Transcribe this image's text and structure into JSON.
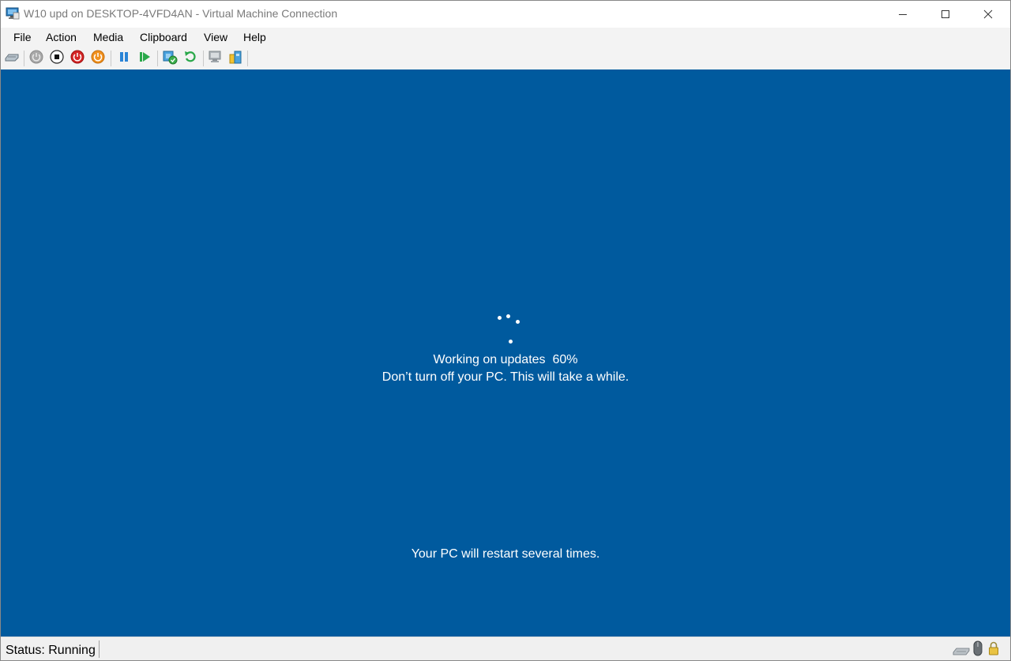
{
  "window": {
    "title": "W10 upd on DESKTOP-4VFD4AN - Virtual Machine Connection",
    "icon": "vm-connection-app-icon"
  },
  "caption_buttons": [
    "minimize-icon",
    "maximize-icon",
    "close-icon"
  ],
  "menu": [
    "File",
    "Action",
    "Media",
    "Clipboard",
    "View",
    "Help"
  ],
  "toolbar": {
    "icons": [
      "ctrl-alt-del-icon",
      "start-icon",
      "turn-off-icon",
      "shut-down-icon",
      "save-icon",
      "pause-icon",
      "resume-icon",
      "checkpoint-icon",
      "revert-icon",
      "enhanced-session-icon",
      "share-icon"
    ]
  },
  "vm_screen": {
    "background_color": "#005a9e",
    "status_line": "Working on updates  60%",
    "progress_percent": 60,
    "warning_line": "Don’t turn off your PC. This will take a while.",
    "footer_line": "Your PC will restart several times."
  },
  "statusbar": {
    "status_text": "Status: Running",
    "tray_icons": [
      "keyboard-icon",
      "mouse-icon",
      "lock-icon"
    ]
  }
}
